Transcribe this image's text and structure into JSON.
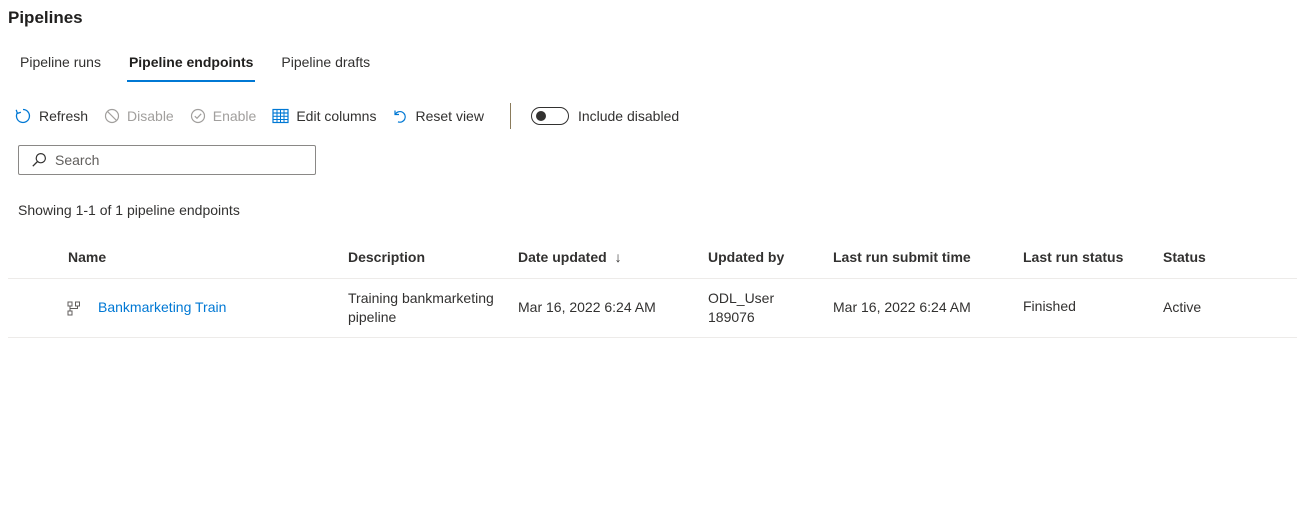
{
  "page": {
    "title": "Pipelines"
  },
  "tabs": [
    {
      "label": "Pipeline runs",
      "active": false
    },
    {
      "label": "Pipeline endpoints",
      "active": true
    },
    {
      "label": "Pipeline drafts",
      "active": false
    }
  ],
  "toolbar": {
    "refresh": "Refresh",
    "disable": "Disable",
    "enable": "Enable",
    "edit_columns": "Edit columns",
    "reset_view": "Reset view",
    "include_disabled": "Include disabled",
    "include_disabled_on": false
  },
  "search": {
    "placeholder": "Search",
    "value": ""
  },
  "summary": "Showing 1-1 of 1 pipeline endpoints",
  "table": {
    "columns": {
      "name": "Name",
      "description": "Description",
      "date_updated": "Date updated",
      "sort_indicator": "↓",
      "updated_by": "Updated by",
      "last_run_submit_time": "Last run submit time",
      "last_run_status": "Last run status",
      "status": "Status"
    },
    "rows": [
      {
        "name": "Bankmarketing Train",
        "description_line1": "Training bankmarketing",
        "description_line2": "pipeline",
        "date_updated": "Mar 16, 2022 6:24 AM",
        "updated_by_line1": "ODL_User",
        "updated_by_line2": "189076",
        "last_run_submit_time": "Mar 16, 2022 6:24 AM",
        "last_run_status": "Finished",
        "status": "Active"
      }
    ]
  },
  "colors": {
    "accent": "#0078d4",
    "text": "#323130",
    "disabled": "#a19f9d"
  },
  "icons": {
    "refresh": "refresh-icon",
    "disable": "disable-icon",
    "enable": "enable-icon",
    "edit_columns": "table-icon",
    "reset_view": "undo-icon",
    "search": "search-icon",
    "pipeline": "pipeline-icon"
  }
}
